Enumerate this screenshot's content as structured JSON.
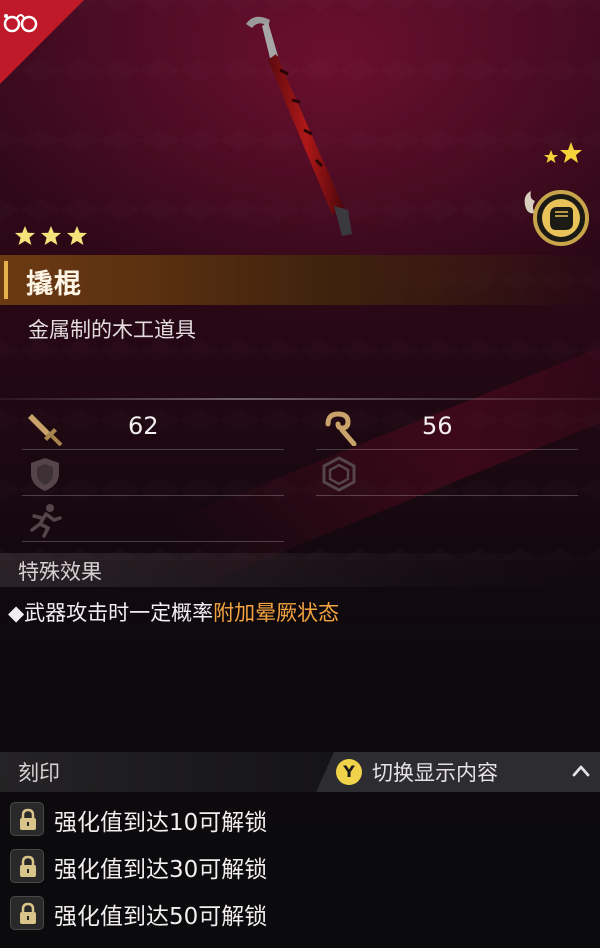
{
  "item": {
    "name": "撬棍",
    "description": "金属制的木工道具",
    "rarity": 3,
    "rank_stars": 2
  },
  "stats": {
    "attack": {
      "icon": "sword-icon",
      "value": "62"
    },
    "heat": {
      "icon": "hook-icon",
      "value": "56"
    },
    "defense": {
      "icon": "shield-icon",
      "value": ""
    },
    "guard": {
      "icon": "hexagon-icon",
      "value": ""
    },
    "speed": {
      "icon": "running-icon",
      "value": ""
    }
  },
  "special": {
    "title": "特殊效果",
    "bullet": "◆",
    "text_plain": "武器攻击时一定概率",
    "text_highlight": "附加晕厥状态"
  },
  "engrave": {
    "title": "刻印",
    "toggle": {
      "button": "Y",
      "label": "切换显示内容"
    },
    "slots": [
      {
        "text": "强化值到达10可解锁"
      },
      {
        "text": "强化值到达30可解锁"
      },
      {
        "text": "强化值到达50可解锁"
      }
    ]
  },
  "colors": {
    "highlight": "#f3a340",
    "corner_badge": "#c01a2a",
    "star": "#f5d23a",
    "name_bar_accent": "#e8b24a"
  }
}
